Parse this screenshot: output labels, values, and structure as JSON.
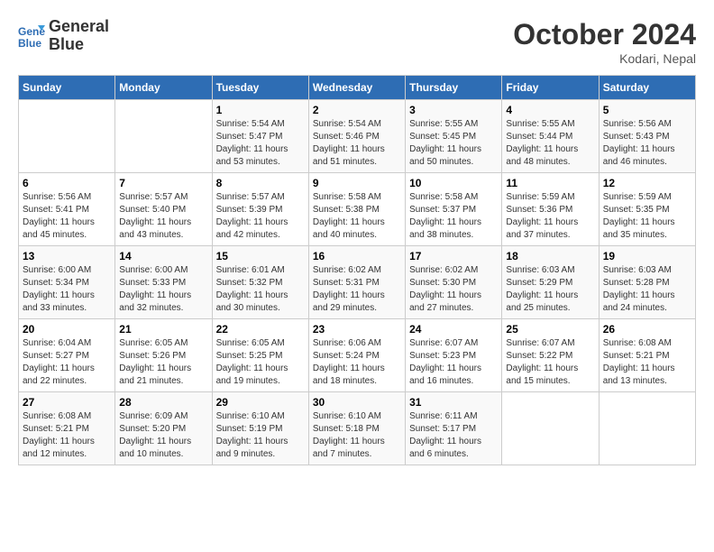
{
  "logo": {
    "line1": "General",
    "line2": "Blue"
  },
  "title": "October 2024",
  "location": "Kodari, Nepal",
  "days_header": [
    "Sunday",
    "Monday",
    "Tuesday",
    "Wednesday",
    "Thursday",
    "Friday",
    "Saturday"
  ],
  "weeks": [
    [
      {
        "day": "",
        "info": ""
      },
      {
        "day": "",
        "info": ""
      },
      {
        "day": "1",
        "info": "Sunrise: 5:54 AM\nSunset: 5:47 PM\nDaylight: 11 hours and 53 minutes."
      },
      {
        "day": "2",
        "info": "Sunrise: 5:54 AM\nSunset: 5:46 PM\nDaylight: 11 hours and 51 minutes."
      },
      {
        "day": "3",
        "info": "Sunrise: 5:55 AM\nSunset: 5:45 PM\nDaylight: 11 hours and 50 minutes."
      },
      {
        "day": "4",
        "info": "Sunrise: 5:55 AM\nSunset: 5:44 PM\nDaylight: 11 hours and 48 minutes."
      },
      {
        "day": "5",
        "info": "Sunrise: 5:56 AM\nSunset: 5:43 PM\nDaylight: 11 hours and 46 minutes."
      }
    ],
    [
      {
        "day": "6",
        "info": "Sunrise: 5:56 AM\nSunset: 5:41 PM\nDaylight: 11 hours and 45 minutes."
      },
      {
        "day": "7",
        "info": "Sunrise: 5:57 AM\nSunset: 5:40 PM\nDaylight: 11 hours and 43 minutes."
      },
      {
        "day": "8",
        "info": "Sunrise: 5:57 AM\nSunset: 5:39 PM\nDaylight: 11 hours and 42 minutes."
      },
      {
        "day": "9",
        "info": "Sunrise: 5:58 AM\nSunset: 5:38 PM\nDaylight: 11 hours and 40 minutes."
      },
      {
        "day": "10",
        "info": "Sunrise: 5:58 AM\nSunset: 5:37 PM\nDaylight: 11 hours and 38 minutes."
      },
      {
        "day": "11",
        "info": "Sunrise: 5:59 AM\nSunset: 5:36 PM\nDaylight: 11 hours and 37 minutes."
      },
      {
        "day": "12",
        "info": "Sunrise: 5:59 AM\nSunset: 5:35 PM\nDaylight: 11 hours and 35 minutes."
      }
    ],
    [
      {
        "day": "13",
        "info": "Sunrise: 6:00 AM\nSunset: 5:34 PM\nDaylight: 11 hours and 33 minutes."
      },
      {
        "day": "14",
        "info": "Sunrise: 6:00 AM\nSunset: 5:33 PM\nDaylight: 11 hours and 32 minutes."
      },
      {
        "day": "15",
        "info": "Sunrise: 6:01 AM\nSunset: 5:32 PM\nDaylight: 11 hours and 30 minutes."
      },
      {
        "day": "16",
        "info": "Sunrise: 6:02 AM\nSunset: 5:31 PM\nDaylight: 11 hours and 29 minutes."
      },
      {
        "day": "17",
        "info": "Sunrise: 6:02 AM\nSunset: 5:30 PM\nDaylight: 11 hours and 27 minutes."
      },
      {
        "day": "18",
        "info": "Sunrise: 6:03 AM\nSunset: 5:29 PM\nDaylight: 11 hours and 25 minutes."
      },
      {
        "day": "19",
        "info": "Sunrise: 6:03 AM\nSunset: 5:28 PM\nDaylight: 11 hours and 24 minutes."
      }
    ],
    [
      {
        "day": "20",
        "info": "Sunrise: 6:04 AM\nSunset: 5:27 PM\nDaylight: 11 hours and 22 minutes."
      },
      {
        "day": "21",
        "info": "Sunrise: 6:05 AM\nSunset: 5:26 PM\nDaylight: 11 hours and 21 minutes."
      },
      {
        "day": "22",
        "info": "Sunrise: 6:05 AM\nSunset: 5:25 PM\nDaylight: 11 hours and 19 minutes."
      },
      {
        "day": "23",
        "info": "Sunrise: 6:06 AM\nSunset: 5:24 PM\nDaylight: 11 hours and 18 minutes."
      },
      {
        "day": "24",
        "info": "Sunrise: 6:07 AM\nSunset: 5:23 PM\nDaylight: 11 hours and 16 minutes."
      },
      {
        "day": "25",
        "info": "Sunrise: 6:07 AM\nSunset: 5:22 PM\nDaylight: 11 hours and 15 minutes."
      },
      {
        "day": "26",
        "info": "Sunrise: 6:08 AM\nSunset: 5:21 PM\nDaylight: 11 hours and 13 minutes."
      }
    ],
    [
      {
        "day": "27",
        "info": "Sunrise: 6:08 AM\nSunset: 5:21 PM\nDaylight: 11 hours and 12 minutes."
      },
      {
        "day": "28",
        "info": "Sunrise: 6:09 AM\nSunset: 5:20 PM\nDaylight: 11 hours and 10 minutes."
      },
      {
        "day": "29",
        "info": "Sunrise: 6:10 AM\nSunset: 5:19 PM\nDaylight: 11 hours and 9 minutes."
      },
      {
        "day": "30",
        "info": "Sunrise: 6:10 AM\nSunset: 5:18 PM\nDaylight: 11 hours and 7 minutes."
      },
      {
        "day": "31",
        "info": "Sunrise: 6:11 AM\nSunset: 5:17 PM\nDaylight: 11 hours and 6 minutes."
      },
      {
        "day": "",
        "info": ""
      },
      {
        "day": "",
        "info": ""
      }
    ]
  ]
}
